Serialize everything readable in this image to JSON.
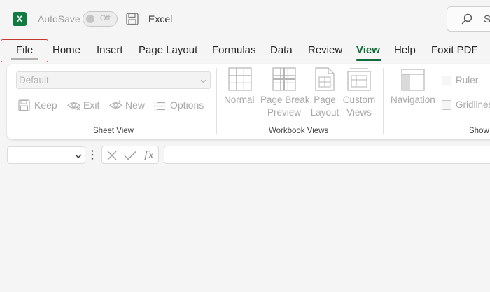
{
  "titlebar": {
    "logo_letter": "X",
    "autosave_label": "AutoSave",
    "autosave_state": "Off",
    "app_name": "Excel",
    "search_text": "S"
  },
  "menu": {
    "tabs": [
      {
        "id": "file",
        "label": "File",
        "highlighted": true
      },
      {
        "id": "home",
        "label": "Home"
      },
      {
        "id": "insert",
        "label": "Insert"
      },
      {
        "id": "page-layout",
        "label": "Page Layout"
      },
      {
        "id": "formulas",
        "label": "Formulas"
      },
      {
        "id": "data",
        "label": "Data"
      },
      {
        "id": "review",
        "label": "Review"
      },
      {
        "id": "view",
        "label": "View",
        "selected": true
      },
      {
        "id": "help",
        "label": "Help"
      },
      {
        "id": "foxit-pdf",
        "label": "Foxit PDF"
      }
    ]
  },
  "ribbon": {
    "sheet_view": {
      "select_value": "Default",
      "keep": "Keep",
      "exit": "Exit",
      "new": "New",
      "options": "Options",
      "group_label": "Sheet View"
    },
    "workbook_views": {
      "normal": "Normal",
      "page_break_line1": "Page Break",
      "page_break_line2": "Preview",
      "page_layout_line1": "Page",
      "page_layout_line2": "Layout",
      "custom_line1": "Custom",
      "custom_line2": "Views",
      "group_label": "Workbook Views"
    },
    "show": {
      "navigation": "Navigation",
      "ruler": "Ruler",
      "gridlines": "Gridlines",
      "group_label": "Show"
    }
  },
  "formula_bar": {
    "fx_label": "fx",
    "namebox_value": "",
    "formula_value": ""
  },
  "colors": {
    "accent": "#0f6b3b",
    "highlight_border": "#c53a32",
    "excel_green": "#107c41"
  }
}
